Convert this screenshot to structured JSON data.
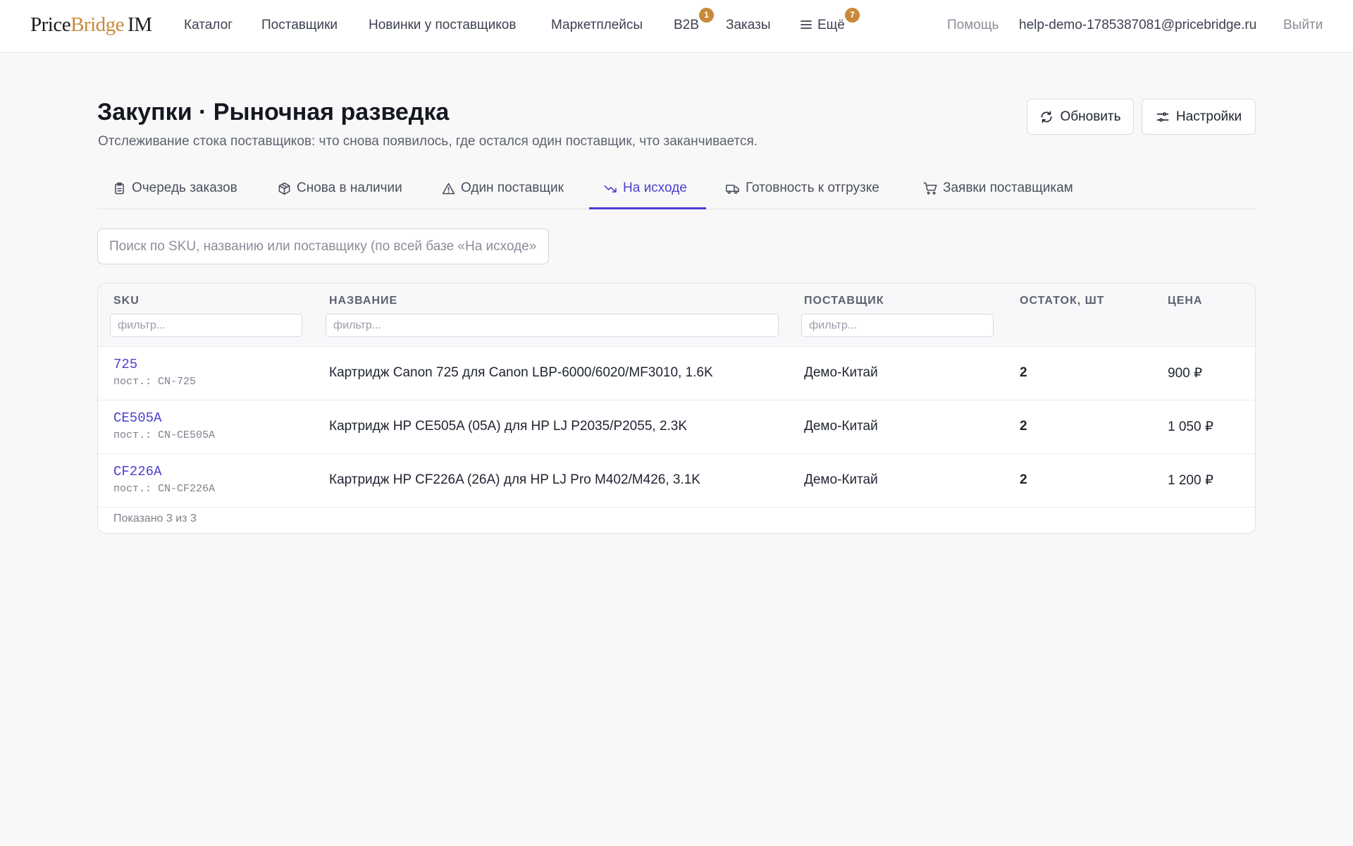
{
  "nav": {
    "logo": {
      "part1": "Price",
      "part2": "Bridge",
      "part3": "IM"
    },
    "items": [
      {
        "label": "Каталог"
      },
      {
        "label": "Поставщики"
      },
      {
        "label": "Новинки у поставщиков"
      },
      {
        "label": "Маркетплейсы"
      },
      {
        "label": "B2B",
        "badge": "1"
      },
      {
        "label": "Заказы"
      },
      {
        "label": "Ещё",
        "badge": "7",
        "icon": "menu-icon"
      }
    ],
    "help": "Помощь",
    "email": "help-demo-1785387081@pricebridge.ru",
    "logout": "Выйти"
  },
  "header": {
    "title": "Закупки · Рыночная разведка",
    "subtitle": "Отслеживание стока поставщиков: что снова появилось, где остался один поставщик, что заканчивается.",
    "refresh_label": "Обновить",
    "settings_label": "Настройки"
  },
  "tabs": [
    {
      "label": "Очередь заказов",
      "icon": "clipboard-icon"
    },
    {
      "label": "Снова в наличии",
      "icon": "package-icon"
    },
    {
      "label": "Один поставщик",
      "icon": "warning-icon"
    },
    {
      "label": "На исходе",
      "icon": "trending-down-icon",
      "active": true
    },
    {
      "label": "Готовность к отгрузке",
      "icon": "truck-icon"
    },
    {
      "label": "Заявки поставщикам",
      "icon": "cart-icon"
    }
  ],
  "search": {
    "placeholder": "Поиск по SKU, названию или поставщику (по всей базе «На исходе»)",
    "value": ""
  },
  "table": {
    "columns": [
      "SKU",
      "НАЗВАНИЕ",
      "ПОСТАВЩИК",
      "ОСТАТОК, ШТ",
      "ЦЕНА"
    ],
    "filter_placeholder": "фильтр...",
    "rows": [
      {
        "sku": "725",
        "supplier_sku": "пост.: CN-725",
        "name": "Картридж Canon 725 для Canon LBP-6000/6020/MF3010, 1.6K",
        "supplier": "Демо-Китай",
        "stock": "2",
        "price": "900 ₽"
      },
      {
        "sku": "CE505A",
        "supplier_sku": "пост.: CN-CE505A",
        "name": "Картридж HP CE505A (05A) для HP LJ P2035/P2055, 2.3K",
        "supplier": "Демо-Китай",
        "stock": "2",
        "price": "1 050 ₽"
      },
      {
        "sku": "CF226A",
        "supplier_sku": "пост.: CN-CF226A",
        "name": "Картридж HP CF226A (26A) для HP LJ Pro M402/M426, 3.1K",
        "supplier": "Демо-Китай",
        "stock": "2",
        "price": "1 200 ₽"
      }
    ],
    "footer": "Показано 3 из 3"
  },
  "colors": {
    "accent": "#4c3fd0",
    "brand_gold": "#c98a3a",
    "badge": "#c7893a"
  }
}
